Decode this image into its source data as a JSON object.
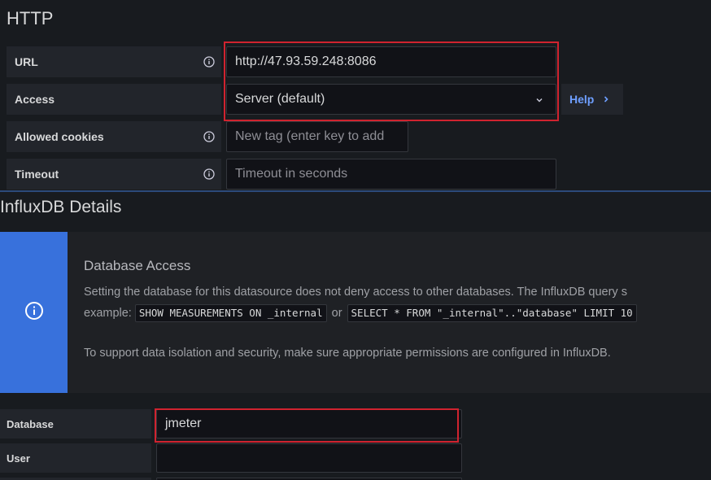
{
  "http": {
    "title": "HTTP",
    "fields": {
      "url": {
        "label": "URL",
        "value": "http://47.93.59.248:8086"
      },
      "access": {
        "label": "Access",
        "value": "Server (default)"
      },
      "cookies": {
        "label": "Allowed cookies",
        "placeholder": "New tag (enter key to add"
      },
      "timeout": {
        "label": "Timeout",
        "placeholder": "Timeout in seconds"
      }
    },
    "help_label": "Help",
    "help_icon": "chevron-right-icon"
  },
  "influx": {
    "title": "InfluxDB Details",
    "alert": {
      "icon": "info-icon",
      "title": "Database Access",
      "line1": "Setting the database for this datasource does not deny access to other databases. The InfluxDB query s",
      "line2_prefix": "example:",
      "code1": "SHOW MEASUREMENTS ON _internal",
      "or": "or",
      "code2": "SELECT * FROM \"_internal\"..\"database\" LIMIT 10",
      "line3": "To support data isolation and security, make sure appropriate permissions are configured in InfluxDB."
    },
    "database": {
      "label": "Database",
      "value": "jmeter"
    },
    "user": {
      "label": "User",
      "value": ""
    }
  },
  "colors": {
    "accent": "#3871dc",
    "link": "#6e9fff",
    "highlight": "#d0232f",
    "background": "#181b1f"
  }
}
